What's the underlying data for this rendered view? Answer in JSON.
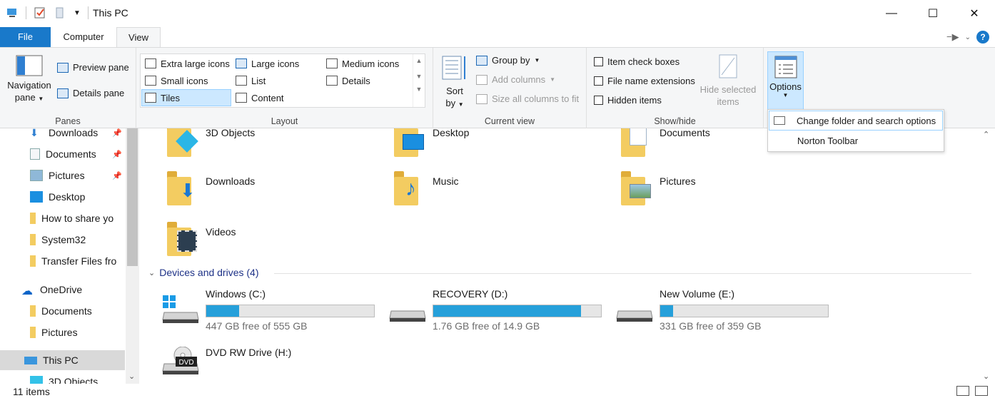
{
  "window": {
    "title": "This PC"
  },
  "tabs": {
    "file": "File",
    "computer": "Computer",
    "view": "View"
  },
  "ribbon": {
    "panes": {
      "navigation_pane": "Navigation",
      "navigation_pane_2": "pane",
      "preview_pane": "Preview pane",
      "details_pane": "Details pane",
      "label": "Panes"
    },
    "layout": {
      "extra_large": "Extra large icons",
      "large": "Large icons",
      "medium": "Medium icons",
      "small": "Small icons",
      "list": "List",
      "details": "Details",
      "tiles": "Tiles",
      "content": "Content",
      "label": "Layout"
    },
    "current_view": {
      "sort_by": "Sort",
      "sort_by_2": "by",
      "group_by": "Group by",
      "add_columns": "Add columns",
      "size_columns": "Size all columns to fit",
      "label": "Current view"
    },
    "show_hide": {
      "item_check_boxes": "Item check boxes",
      "file_name_extensions": "File name extensions",
      "hidden_items": "Hidden items",
      "hide_selected": "Hide selected",
      "hide_selected_2": "items",
      "label": "Show/hide"
    },
    "options": {
      "label": "Options"
    }
  },
  "options_menu": {
    "change_folder": "Change folder and search options",
    "norton": "Norton Toolbar"
  },
  "nav": {
    "items": [
      {
        "label": "Downloads"
      },
      {
        "label": "Documents"
      },
      {
        "label": "Pictures"
      },
      {
        "label": "Desktop"
      },
      {
        "label": "How to share yo"
      },
      {
        "label": "System32"
      },
      {
        "label": "Transfer Files fro"
      },
      {
        "label": "OneDrive"
      },
      {
        "label": "Documents"
      },
      {
        "label": "Pictures"
      },
      {
        "label": "This PC"
      },
      {
        "label": "3D Objects"
      }
    ]
  },
  "folders": [
    {
      "name": "3D Objects"
    },
    {
      "name": "Desktop"
    },
    {
      "name": "Documents"
    },
    {
      "name": "Downloads"
    },
    {
      "name": "Music"
    },
    {
      "name": "Pictures"
    },
    {
      "name": "Videos"
    }
  ],
  "devices": {
    "header": "Devices and drives (4)",
    "drives": [
      {
        "name": "Windows (C:)",
        "free": "447 GB free of 555 GB",
        "used_fraction": 0.195
      },
      {
        "name": "RECOVERY (D:)",
        "free": "1.76 GB free of 14.9 GB",
        "used_fraction": 0.88
      },
      {
        "name": "New Volume (E:)",
        "free": "331 GB free of 359 GB",
        "used_fraction": 0.078
      },
      {
        "name": "DVD RW Drive (H:)",
        "free": ""
      }
    ]
  },
  "status": {
    "items": "11 items"
  },
  "colors": {
    "accent": "#1979ca",
    "bar": "#26a0da",
    "folder": "#f3cc61"
  }
}
